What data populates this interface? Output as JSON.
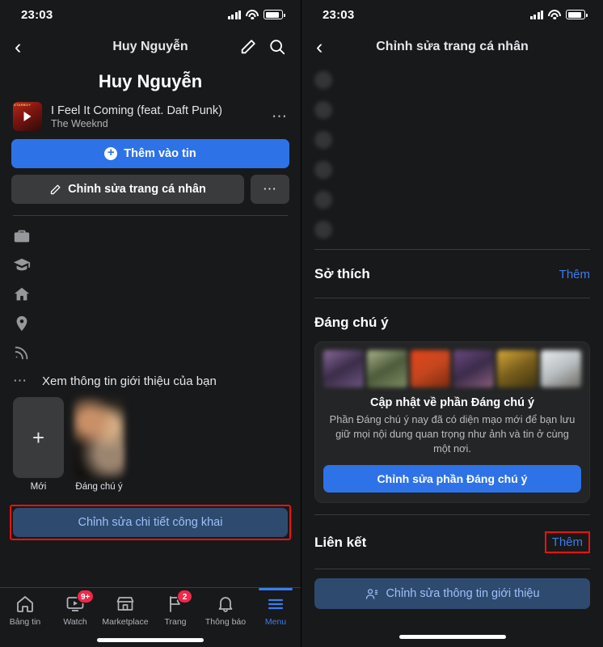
{
  "left": {
    "status": {
      "time": "23:03",
      "signal_icon": "signal-bars-icon",
      "wifi_icon": "wifi-icon",
      "battery_icon": "battery-icon"
    },
    "nav": {
      "back_icon": "chevron-left-icon",
      "title": "Huy Nguyễn",
      "edit_icon": "pencil-icon",
      "search_icon": "search-icon"
    },
    "profile_name": "Huy Nguyễn",
    "music": {
      "title": "I Feel It Coming (feat. Daft Punk)",
      "artist": "The Weeknd",
      "album_tag": "STARBOY",
      "play_icon": "play-icon",
      "more_icon": "ellipsis-icon"
    },
    "buttons": {
      "add_story": "Thêm vào tin",
      "add_story_icon": "plus-circle-icon",
      "edit_profile": "Chỉnh sửa trang cá nhân",
      "edit_profile_icon": "pencil-icon",
      "more_icon": "ellipsis-icon"
    },
    "info_rows": [
      {
        "icon": "briefcase-icon",
        "lines": 2
      },
      {
        "icon": "graduation-cap-icon",
        "lines": 2
      },
      {
        "icon": "home-icon",
        "lines": 1
      },
      {
        "icon": "location-pin-icon",
        "lines": 1
      },
      {
        "icon": "rss-icon",
        "lines": 1
      }
    ],
    "see_info": {
      "icon": "ellipsis-icon",
      "label": "Xem thông tin giới thiệu của bạn"
    },
    "tiles": [
      {
        "type": "new",
        "icon": "plus-icon",
        "label": "Mới"
      },
      {
        "type": "photo",
        "label": "Đáng chú ý"
      }
    ],
    "public_details_button": "Chỉnh sửa chi tiết công khai",
    "highlight_color": "#ee1111",
    "tabs": [
      {
        "label": "Bảng tin",
        "icon": "home-icon",
        "badge": "",
        "active": false
      },
      {
        "label": "Watch",
        "icon": "watch-icon",
        "badge": "9+",
        "active": false
      },
      {
        "label": "Marketplace",
        "icon": "marketplace-icon",
        "badge": "",
        "active": false
      },
      {
        "label": "Trang",
        "icon": "flag-icon",
        "badge": "2",
        "active": false
      },
      {
        "label": "Thông báo",
        "icon": "bell-icon",
        "badge": "",
        "active": false
      },
      {
        "label": "Menu",
        "icon": "hamburger-icon",
        "badge": "",
        "active": true
      }
    ]
  },
  "right": {
    "status": {
      "time": "23:03",
      "signal_icon": "signal-bars-icon",
      "wifi_icon": "wifi-icon",
      "battery_icon": "battery-icon"
    },
    "nav": {
      "back_icon": "chevron-left-icon",
      "title": "Chỉnh sửa trang cá nhân"
    },
    "blurred_rows": [
      2,
      2,
      1,
      1,
      1,
      1
    ],
    "sections": [
      {
        "title": "Sở thích",
        "link": "Thêm",
        "link_boxed": false
      },
      {
        "title": "Đáng chú ý",
        "link": "",
        "link_boxed": false
      },
      {
        "title": "Liên kết",
        "link": "Thêm",
        "link_boxed": true
      }
    ],
    "featured_card": {
      "title": "Cập nhật về phần Đáng chú ý",
      "body": "Phần Đáng chú ý nay đã có diện mạo mới để bạn lưu giữ mọi nội dung quan trọng như ảnh và tin ở cùng một nơi.",
      "button": "Chỉnh sửa phần Đáng chú ý",
      "thumb_colors": [
        "#8a6a9c",
        "#7f8d63",
        "#c4471f",
        "#6b4a80",
        "#b98f2c",
        "#cfd3d6"
      ]
    },
    "intro_button": {
      "label": "Chỉnh sửa thông tin giới thiệu",
      "icon": "user-edit-icon"
    },
    "highlight_color": "#ee1111"
  }
}
